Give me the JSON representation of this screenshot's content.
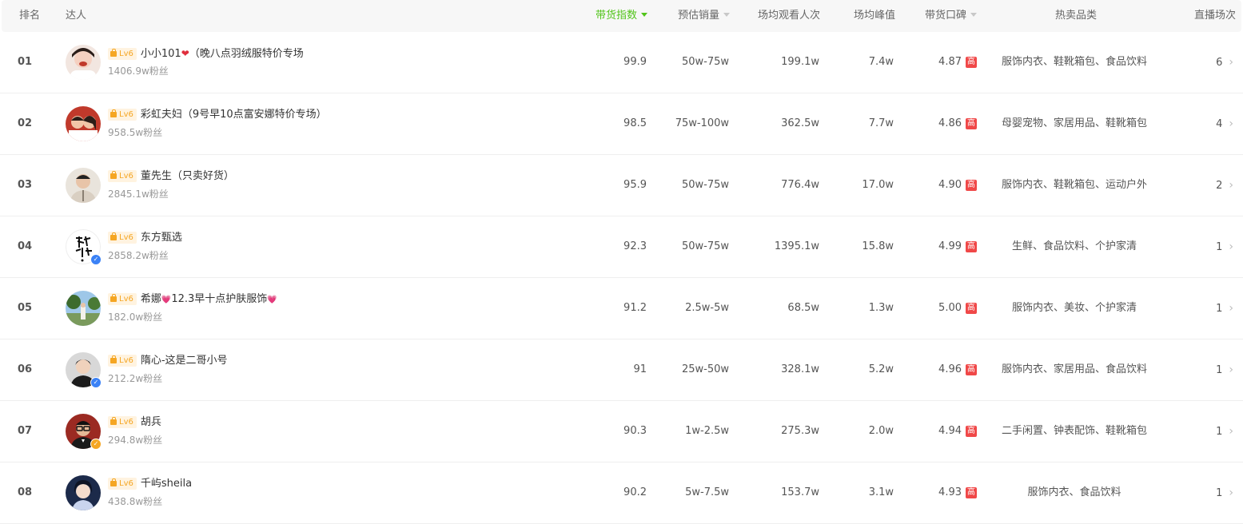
{
  "header": {
    "rank": "排名",
    "talent": "达人",
    "sales_index": "带货指数",
    "est_sales": "预估销量",
    "avg_viewers": "场均观看人次",
    "avg_peak": "场均峰值",
    "reputation": "带货口碑",
    "hot_categories": "热卖品类",
    "live_sessions": "直播场次"
  },
  "colors": {
    "accent": "#52c41a",
    "high_badge": "#f04848",
    "level_badge": "#f5a623"
  },
  "rows": [
    {
      "rank": "01",
      "level": "Lv6",
      "name": "小小101",
      "heart": "❤",
      "name_suffix": "（晚八点羽绒服特价专场",
      "fans": "1406.9w粉丝",
      "index": "99.9",
      "sales": "50w-75w",
      "viewers": "199.1w",
      "peak": "7.4w",
      "score": "4.87",
      "badge": "高",
      "categories": "服饰内衣、鞋靴箱包、食品饮料",
      "sessions": "6"
    },
    {
      "rank": "02",
      "level": "Lv6",
      "name": "彩虹夫妇（9号早10点富安娜特价专场）",
      "fans": "958.5w粉丝",
      "index": "98.5",
      "sales": "75w-100w",
      "viewers": "362.5w",
      "peak": "7.7w",
      "score": "4.86",
      "badge": "高",
      "categories": "母婴宠物、家居用品、鞋靴箱包",
      "sessions": "4"
    },
    {
      "rank": "03",
      "level": "Lv6",
      "name": "董先生（只卖好货）",
      "fans": "2845.1w粉丝",
      "index": "95.9",
      "sales": "50w-75w",
      "viewers": "776.4w",
      "peak": "17.0w",
      "score": "4.90",
      "badge": "高",
      "categories": "服饰内衣、鞋靴箱包、运动户外",
      "sessions": "2"
    },
    {
      "rank": "04",
      "level": "Lv6",
      "name": "东方甄选",
      "fans": "2858.2w粉丝",
      "index": "92.3",
      "sales": "50w-75w",
      "viewers": "1395.1w",
      "peak": "15.8w",
      "score": "4.99",
      "badge": "高",
      "categories": "生鲜、食品饮料、个护家清",
      "sessions": "1"
    },
    {
      "rank": "05",
      "level": "Lv6",
      "name": "希娜",
      "heart": "💗",
      "name_suffix": "12.3早十点护肤服饰",
      "heart2": "💗",
      "fans": "182.0w粉丝",
      "index": "91.2",
      "sales": "2.5w-5w",
      "viewers": "68.5w",
      "peak": "1.3w",
      "score": "5.00",
      "badge": "高",
      "categories": "服饰内衣、美妆、个护家清",
      "sessions": "1"
    },
    {
      "rank": "06",
      "level": "Lv6",
      "name": "隋心-这是二哥小号",
      "fans": "212.2w粉丝",
      "index": "91",
      "sales": "25w-50w",
      "viewers": "328.1w",
      "peak": "5.2w",
      "score": "4.96",
      "badge": "高",
      "categories": "服饰内衣、家居用品、食品饮料",
      "sessions": "1"
    },
    {
      "rank": "07",
      "level": "Lv6",
      "name": "胡兵",
      "fans": "294.8w粉丝",
      "index": "90.3",
      "sales": "1w-2.5w",
      "viewers": "275.3w",
      "peak": "2.0w",
      "score": "4.94",
      "badge": "高",
      "categories": "二手闲置、钟表配饰、鞋靴箱包",
      "sessions": "1"
    },
    {
      "rank": "08",
      "level": "Lv6",
      "name": "千屿sheila",
      "fans": "438.8w粉丝",
      "index": "90.2",
      "sales": "5w-7.5w",
      "viewers": "153.7w",
      "peak": "3.1w",
      "score": "4.93",
      "badge": "高",
      "categories": "服饰内衣、食品饮料",
      "sessions": "1"
    }
  ]
}
